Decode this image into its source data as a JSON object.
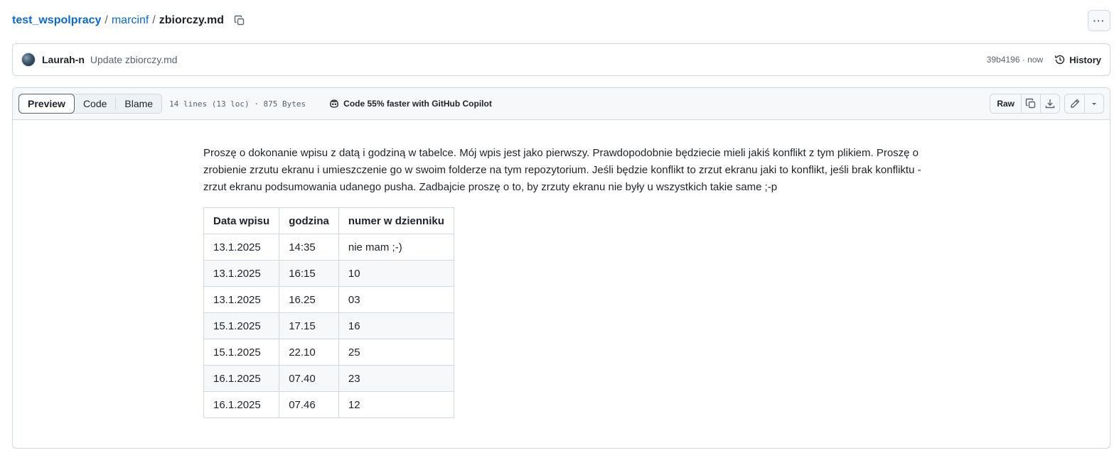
{
  "breadcrumb": {
    "repo": "test_wspolpracy",
    "folder": "marcinf",
    "separator": "/",
    "file": "zbiorczy.md"
  },
  "more_label": "···",
  "commit": {
    "author": "Laurah-n",
    "message": "Update zbiorczy.md",
    "meta": "39b4196 · now",
    "history_label": "History"
  },
  "file_header": {
    "tabs": [
      {
        "label": "Preview",
        "active": true
      },
      {
        "label": "Code",
        "active": false
      },
      {
        "label": "Blame",
        "active": false
      }
    ],
    "info": "14 lines (13 loc) · 875 Bytes",
    "copilot": "Code 55% faster with GitHub Copilot",
    "raw_label": "Raw"
  },
  "content": {
    "paragraph": "Proszę o dokonanie wpisu z datą i godziną w tabelce. Mój wpis jest jako pierwszy. Prawdopodobnie będziecie mieli jakiś konflikt z tym plikiem. Proszę o zrobienie zrzutu ekranu i umieszczenie go w swoim folderze na tym repozytorium. Jeśli będzie konflikt to zrzut ekranu jaki to konflikt, jeśli brak konfliktu - zrzut ekranu podsumowania udanego pusha. Zadbajcie proszę o to, by zrzuty ekranu nie były u wszystkich takie same ;-p",
    "table": {
      "headers": [
        "Data wpisu",
        "godzina",
        "numer w dzienniku"
      ],
      "rows": [
        [
          "13.1.2025",
          "14:35",
          "nie mam ;-)"
        ],
        [
          "13.1.2025",
          "16:15",
          "10"
        ],
        [
          "13.1.2025",
          "16.25",
          "03"
        ],
        [
          "15.1.2025",
          "17.15",
          "16"
        ],
        [
          "15.1.2025",
          "22.10",
          "25"
        ],
        [
          "16.1.2025",
          "07.40",
          "23"
        ],
        [
          "16.1.2025",
          "07.46",
          "12"
        ]
      ]
    }
  }
}
